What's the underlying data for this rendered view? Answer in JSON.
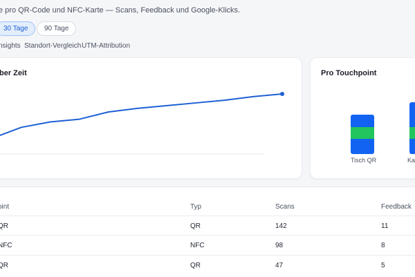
{
  "header": {
    "subtitle": "e pro QR-Code und NFC-Karte — Scans, Feedback und Google-Klicks."
  },
  "range": {
    "options": [
      "30 Tage",
      "90 Tage"
    ],
    "selected": "30 Tage"
  },
  "tabs": [
    "nsights",
    "Standort-Vergleich",
    "UTM-Attribution"
  ],
  "line_card": {
    "title": "ber Zeit"
  },
  "touchpoint_card": {
    "title": "Pro Touchpoint",
    "bars": [
      {
        "label": "Tisch QR"
      },
      {
        "label": "Kas"
      }
    ]
  },
  "table": {
    "headers": [
      "oint",
      "Typ",
      "Scans",
      "Feedback"
    ],
    "rows": [
      [
        "QR",
        "QR",
        "142",
        "11"
      ],
      [
        "NFC",
        "NFC",
        "98",
        "8"
      ],
      [
        "QR",
        "QR",
        "47",
        "5"
      ]
    ]
  },
  "colors": {
    "accent": "#1d5fd4",
    "bar_blue": "#1263f1",
    "bar_green": "#22c55e"
  },
  "chart_data": {
    "type": "line",
    "title": "ber Zeit",
    "series": [
      {
        "values": [
          0,
          12,
          18,
          21,
          29,
          33,
          36,
          39,
          42,
          46,
          49
        ]
      }
    ],
    "grid": false
  }
}
